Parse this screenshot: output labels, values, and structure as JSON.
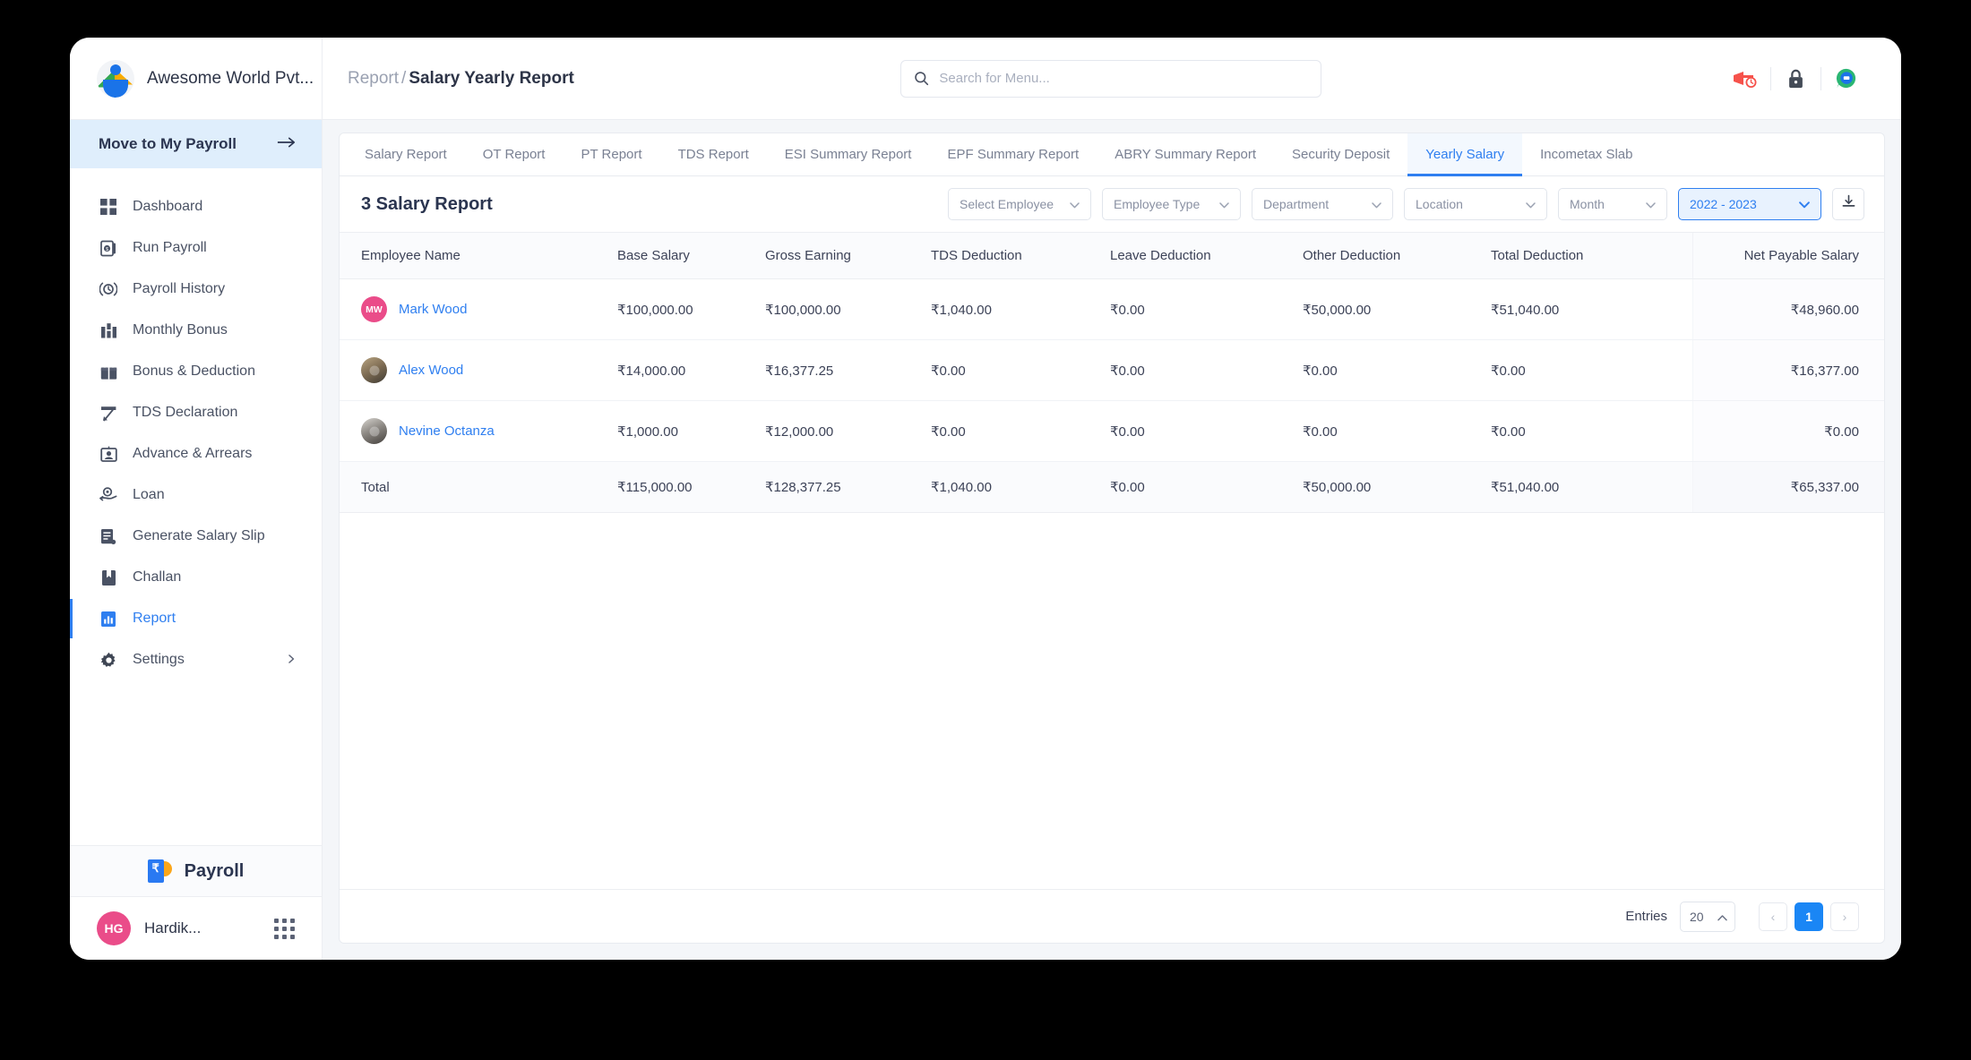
{
  "brand": {
    "name": "Awesome World Pvt...",
    "logo_icon": "company-logo-icon"
  },
  "breadcrumb": {
    "root": "Report",
    "separator": "/",
    "current": "Salary Yearly Report"
  },
  "search": {
    "placeholder": "Search for Menu...",
    "value": "",
    "icon": "search-icon"
  },
  "header_icons": [
    {
      "name": "announcement-clock-icon",
      "glyph": "announcement"
    },
    {
      "name": "lock-icon",
      "glyph": "lock"
    },
    {
      "name": "chat-support-icon",
      "glyph": "chat"
    }
  ],
  "sidebar": {
    "move_payroll": {
      "label": "Move to My Payroll",
      "icon": "arrow-right-icon"
    },
    "items": [
      {
        "label": "Dashboard",
        "icon": "dashboard-grid-icon",
        "active": false
      },
      {
        "label": "Run Payroll",
        "icon": "run-payroll-icon",
        "active": false
      },
      {
        "label": "Payroll History",
        "icon": "payroll-history-icon",
        "active": false
      },
      {
        "label": "Monthly Bonus",
        "icon": "monthly-bonus-icon",
        "active": false
      },
      {
        "label": "Bonus & Deduction",
        "icon": "bonus-deduction-icon",
        "active": false
      },
      {
        "label": "TDS Declaration",
        "icon": "tds-declaration-icon",
        "active": false
      },
      {
        "label": "Advance & Arrears",
        "icon": "advance-arrears-icon",
        "active": false
      },
      {
        "label": "Loan",
        "icon": "loan-icon",
        "active": false
      },
      {
        "label": "Generate Salary Slip",
        "icon": "salary-slip-icon",
        "active": false
      },
      {
        "label": "Challan",
        "icon": "challan-icon",
        "active": false
      },
      {
        "label": "Report",
        "icon": "report-chart-icon",
        "active": true
      },
      {
        "label": "Settings",
        "icon": "gear-icon",
        "active": false,
        "has_submenu": true
      }
    ],
    "payroll_badge": {
      "label": "Payroll",
      "icon": "payroll-rupee-icon",
      "symbol": "₹"
    },
    "user": {
      "initials": "HG",
      "name": "Hardik...",
      "apps_icon": "apps-grid-icon"
    }
  },
  "tabs": [
    {
      "label": "Salary Report",
      "active": false
    },
    {
      "label": "OT Report",
      "active": false
    },
    {
      "label": "PT Report",
      "active": false
    },
    {
      "label": "TDS Report",
      "active": false
    },
    {
      "label": "ESI Summary Report",
      "active": false
    },
    {
      "label": "EPF Summary Report",
      "active": false
    },
    {
      "label": "ABRY Summary Report",
      "active": false
    },
    {
      "label": "Security Deposit",
      "active": false
    },
    {
      "label": "Yearly Salary",
      "active": true
    },
    {
      "label": "Incometax Slab",
      "active": false
    }
  ],
  "filters": {
    "report_title": "3 Salary Report",
    "selects": [
      {
        "label": "Select Employee",
        "name": "select-employee",
        "width": "w1",
        "active": false
      },
      {
        "label": "Employee Type",
        "name": "employee-type",
        "width": "w2",
        "active": false
      },
      {
        "label": "Department",
        "name": "department",
        "width": "w3",
        "active": false
      },
      {
        "label": "Location",
        "name": "location",
        "width": "w4",
        "active": false
      },
      {
        "label": "Month",
        "name": "month",
        "width": "w5",
        "active": false
      },
      {
        "label": "2022 - 2023",
        "name": "financial-year",
        "width": "year",
        "active": true
      }
    ],
    "download_icon": "download-icon"
  },
  "table": {
    "columns": [
      "Employee Name",
      "Base Salary",
      "Gross Earning",
      "TDS Deduction",
      "Leave Deduction",
      "Other Deduction",
      "Total Deduction",
      "Net Payable Salary"
    ],
    "rows": [
      {
        "avatar_type": "initials",
        "avatar_initials": "MW",
        "name": "Mark Wood",
        "base_salary": "₹100,000.00",
        "gross_earning": "₹100,000.00",
        "tds_deduction": "₹1,040.00",
        "leave_deduction": "₹0.00",
        "other_deduction": "₹50,000.00",
        "total_deduction": "₹51,040.00",
        "net_payable": "₹48,960.00"
      },
      {
        "avatar_type": "photo-a",
        "avatar_initials": "",
        "name": "Alex Wood",
        "base_salary": "₹14,000.00",
        "gross_earning": "₹16,377.25",
        "tds_deduction": "₹0.00",
        "leave_deduction": "₹0.00",
        "other_deduction": "₹0.00",
        "total_deduction": "₹0.00",
        "net_payable": "₹16,377.00"
      },
      {
        "avatar_type": "photo-b",
        "avatar_initials": "",
        "name": "Nevine Octanza",
        "base_salary": "₹1,000.00",
        "gross_earning": "₹12,000.00",
        "tds_deduction": "₹0.00",
        "leave_deduction": "₹0.00",
        "other_deduction": "₹0.00",
        "total_deduction": "₹0.00",
        "net_payable": "₹0.00"
      }
    ],
    "total_row": {
      "label": "Total",
      "base_salary": "₹115,000.00",
      "gross_earning": "₹128,377.25",
      "tds_deduction": "₹1,040.00",
      "leave_deduction": "₹0.00",
      "other_deduction": "₹50,000.00",
      "total_deduction": "₹51,040.00",
      "net_payable": "₹65,337.00"
    }
  },
  "footer": {
    "entries_label": "Entries",
    "entries_value": "20",
    "prev_label": "‹",
    "current_page": "1",
    "next_label": "›"
  },
  "colors": {
    "accent": "#2f7ff0",
    "page_active": "#1a86f5",
    "avatar_pink": "#ea4c89",
    "sidebar_highlight": "#dfeefc"
  }
}
